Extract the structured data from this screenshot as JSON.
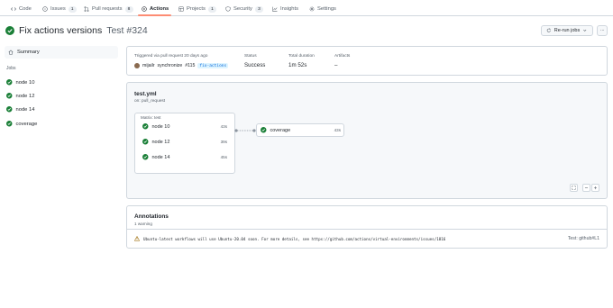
{
  "tabs": [
    {
      "label": "Code",
      "icon": "code-icon"
    },
    {
      "label": "Issues",
      "icon": "issue-icon",
      "count": "1"
    },
    {
      "label": "Pull requests",
      "icon": "pull-request-icon",
      "count": "8"
    },
    {
      "label": "Actions",
      "icon": "play-icon",
      "selected": true
    },
    {
      "label": "Projects",
      "icon": "table-icon",
      "count": "1"
    },
    {
      "label": "Security",
      "icon": "shield-icon",
      "count": "3"
    },
    {
      "label": "Insights",
      "icon": "graph-icon"
    },
    {
      "label": "Settings",
      "icon": "gear-icon"
    }
  ],
  "run": {
    "title": "Fix actions versions",
    "subtitle": "Test #324",
    "rerun_label": "Re-run jobs",
    "more_label": "···"
  },
  "sidebar": {
    "summary_label": "Summary",
    "jobs_heading": "Jobs",
    "jobs": [
      {
        "label": "node 10"
      },
      {
        "label": "node 12"
      },
      {
        "label": "node 14"
      },
      {
        "label": "coverage"
      }
    ]
  },
  "summary_card": {
    "trigger_text": "Triggered via pull request 20 days ago",
    "actor": "mijailr",
    "action": "synchronize",
    "pr_number": "#115",
    "branch": "fix-actions",
    "status_label": "Status",
    "status_value": "Success",
    "duration_label": "Total duration",
    "duration_value": "1m 52s",
    "artifacts_label": "Artifacts",
    "artifacts_value": "–"
  },
  "workflow": {
    "file": "test.yml",
    "trigger": "on: pull_request",
    "matrix_label": "Matrix: test",
    "nodes": [
      {
        "label": "node 10",
        "duration": "43s"
      },
      {
        "label": "node 12",
        "duration": "39s"
      },
      {
        "label": "node 14",
        "duration": "45s"
      }
    ],
    "coverage": {
      "label": "coverage",
      "duration": "43s"
    }
  },
  "annotations": {
    "title": "Annotations",
    "subtitle": "1 warning",
    "warning_text": "Ubuntu-latest workflows will use Ubuntu-20.04 soon. For more details, see https://github.com/actions/virtual-environments/issues/1816",
    "reference": "Test: github#L1"
  },
  "colors": {
    "success": "#1a7f37",
    "warning": "#9a6700",
    "accent_underline": "#fd8c73",
    "border": "#d0d7de"
  }
}
